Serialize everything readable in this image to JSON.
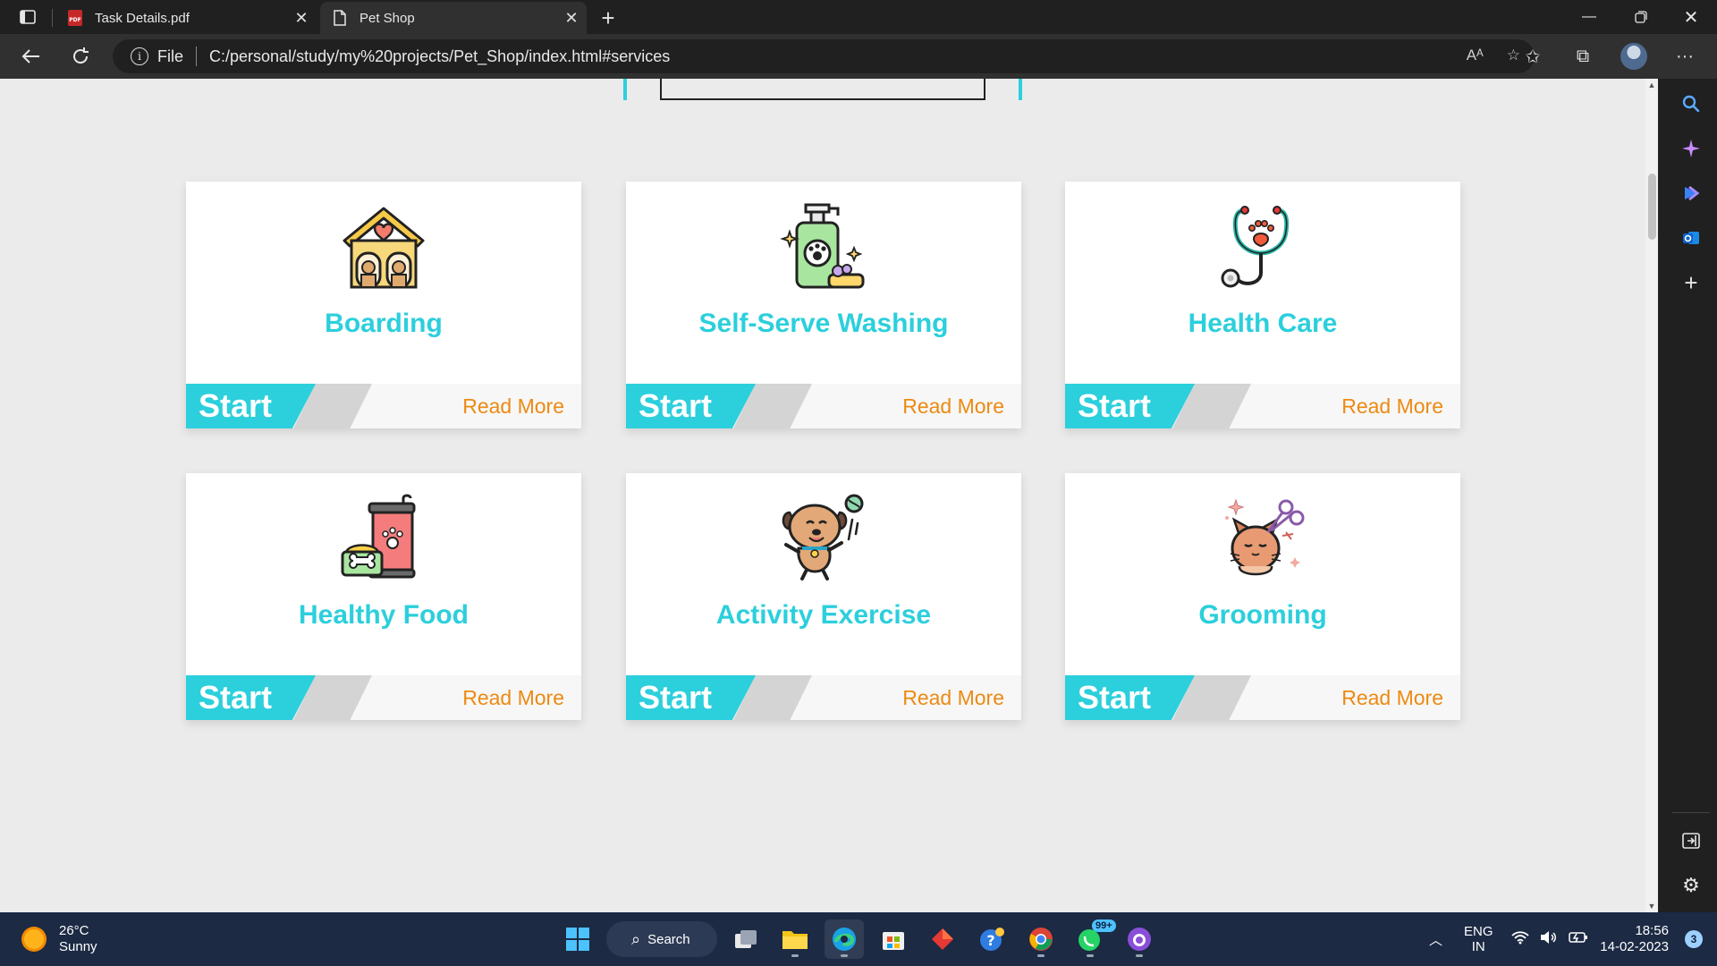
{
  "browser": {
    "tabs": [
      {
        "label": "Task Details.pdf",
        "icon": "pdf-icon"
      },
      {
        "label": "Pet Shop",
        "icon": "page-icon"
      }
    ],
    "omnibox": {
      "scheme_label": "File",
      "url": "C:/personal/study/my%20projects/Pet_Shop/index.html#services"
    }
  },
  "services": [
    {
      "title": "Boarding",
      "icon": "dog-house-icon",
      "start": "Start",
      "more": "Read More"
    },
    {
      "title": "Self-Serve Washing",
      "icon": "shampoo-bottle-icon",
      "start": "Start",
      "more": "Read More"
    },
    {
      "title": "Health Care",
      "icon": "stethoscope-icon",
      "start": "Start",
      "more": "Read More"
    },
    {
      "title": "Healthy Food",
      "icon": "pet-food-icon",
      "start": "Start",
      "more": "Read More"
    },
    {
      "title": "Activity Exercise",
      "icon": "playing-dog-icon",
      "start": "Start",
      "more": "Read More"
    },
    {
      "title": "Grooming",
      "icon": "grooming-cat-icon",
      "start": "Start",
      "more": "Read More"
    }
  ],
  "colors": {
    "accent": "#2ccfdc",
    "read_more": "#ec8a12",
    "page_bg": "#ebebeb"
  },
  "taskbar": {
    "weather": {
      "temp": "26°C",
      "condition": "Sunny"
    },
    "search_label": "Search",
    "whatsapp_badge": "99+",
    "lang": {
      "line1": "ENG",
      "line2": "IN"
    },
    "clock": {
      "time": "18:56",
      "date": "14-02-2023"
    },
    "notifications": "3"
  }
}
